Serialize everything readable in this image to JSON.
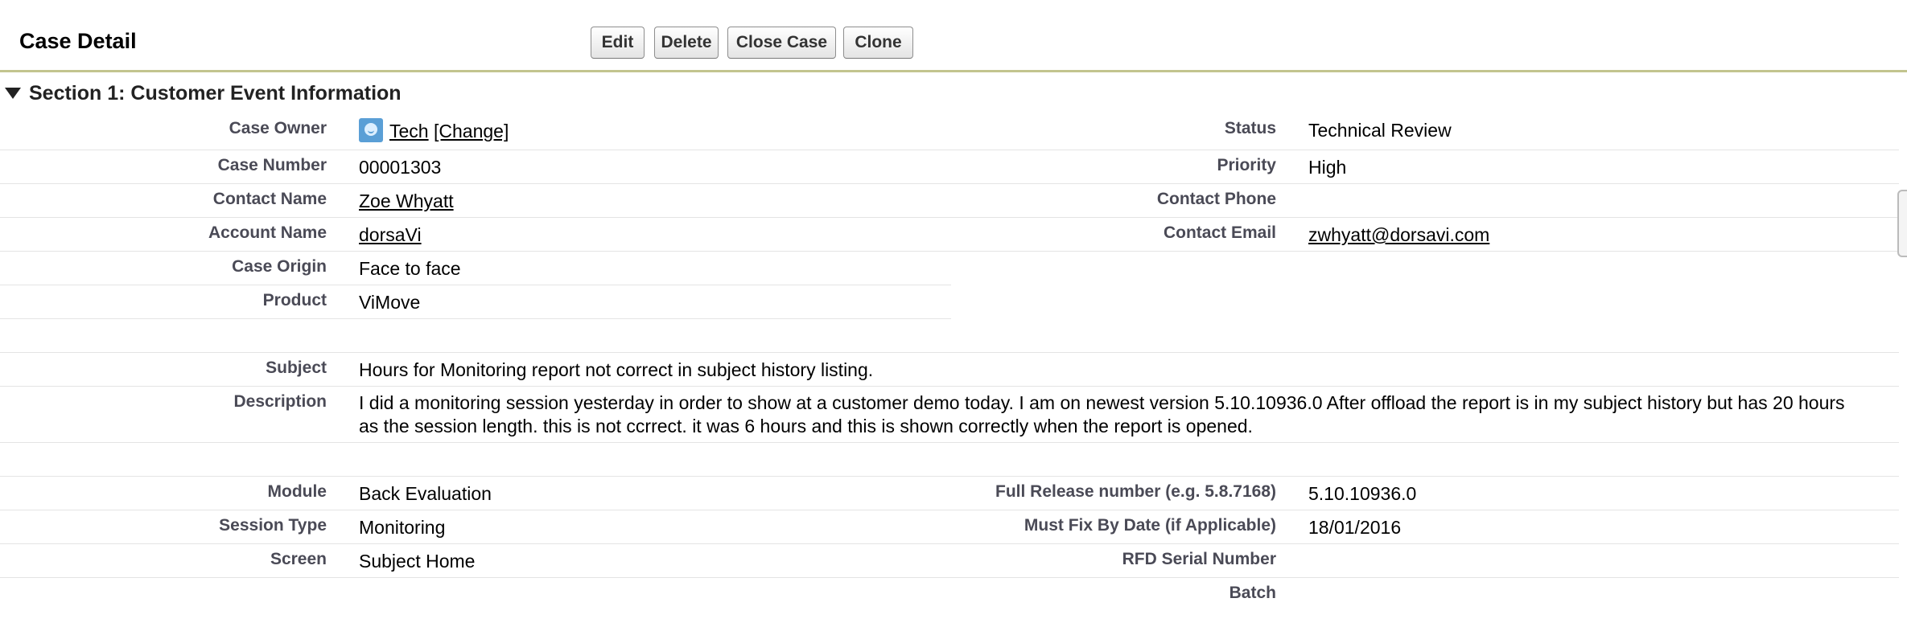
{
  "header": {
    "title": "Case Detail",
    "buttons": {
      "edit": "Edit",
      "delete": "Delete",
      "close_case": "Close Case",
      "clone": "Clone"
    }
  },
  "section": {
    "title": "Section 1: Customer Event Information"
  },
  "fields": {
    "case_owner": {
      "label": "Case Owner",
      "name": "Tech",
      "change": "[Change]",
      "icon": "user-icon"
    },
    "status": {
      "label": "Status",
      "value": "Technical Review"
    },
    "case_number": {
      "label": "Case Number",
      "value": "00001303"
    },
    "priority": {
      "label": "Priority",
      "value": "High"
    },
    "contact_name": {
      "label": "Contact Name",
      "value": "Zoe Whyatt"
    },
    "contact_phone": {
      "label": "Contact Phone",
      "value": ""
    },
    "account_name": {
      "label": "Account Name",
      "value": "dorsaVi"
    },
    "contact_email": {
      "label": "Contact Email",
      "value": "zwhyatt@dorsavi.com"
    },
    "case_origin": {
      "label": "Case Origin",
      "value": "Face to face"
    },
    "product": {
      "label": "Product",
      "value": "ViMove"
    },
    "subject": {
      "label": "Subject",
      "value": "Hours for Monitoring report not correct in subject history listing."
    },
    "description": {
      "label": "Description",
      "value": "I did a monitoring session yesterday in order to show at a customer demo today. I am on newest version 5.10.10936.0 After offload the report is in my subject history but has 20 hours as the session length. this is not ccrrect. it was 6 hours and this is shown correctly when the report is opened."
    },
    "module": {
      "label": "Module",
      "value": "Back Evaluation"
    },
    "full_release": {
      "label": "Full Release number (e.g. 5.8.7168)",
      "value": "5.10.10936.0"
    },
    "session_type": {
      "label": "Session Type",
      "value": "Monitoring"
    },
    "must_fix": {
      "label": "Must Fix By Date (if Applicable)",
      "value": "18/01/2016"
    },
    "screen": {
      "label": "Screen",
      "value": "Subject Home"
    },
    "rfd_serial": {
      "label": "RFD Serial Number",
      "value": ""
    },
    "batch": {
      "label": "Batch",
      "value": ""
    }
  }
}
